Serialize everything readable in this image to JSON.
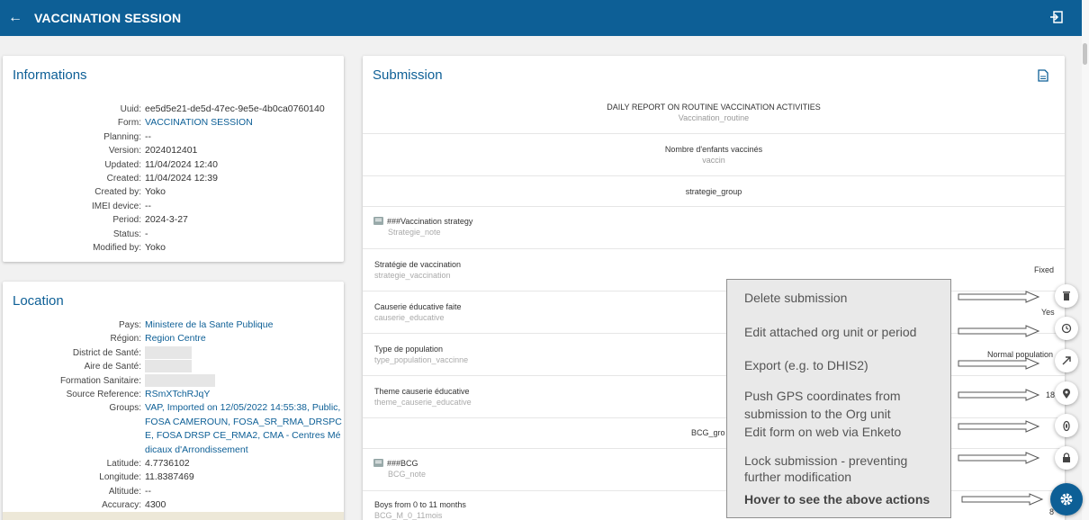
{
  "header": {
    "title": "VACCINATION SESSION",
    "back_icon": "arrow-left-icon",
    "exit_icon": "exit-icon"
  },
  "informations": {
    "title": "Informations",
    "rows": [
      {
        "k": "Uuid:",
        "v": "ee5d5e21-de5d-47ec-9e5e-4b0ca0760140"
      },
      {
        "k": "Form:",
        "v": "VACCINATION SESSION"
      },
      {
        "k": "Planning:",
        "v": "--"
      },
      {
        "k": "Version:",
        "v": "2024012401"
      },
      {
        "k": "Updated:",
        "v": "11/04/2024 12:40"
      },
      {
        "k": "Created:",
        "v": "11/04/2024 12:39"
      },
      {
        "k": "Created by:",
        "v": "Yoko"
      },
      {
        "k": "IMEI device:",
        "v": "--"
      },
      {
        "k": "Period:",
        "v": "2024-3-27"
      },
      {
        "k": "Status:",
        "v": "-"
      },
      {
        "k": "Modified by:",
        "v": "Yoko"
      }
    ]
  },
  "location": {
    "title": "Location",
    "rows": [
      {
        "k": "Pays:",
        "v": "Ministere de la Sante Publique"
      },
      {
        "k": "Région:",
        "v": "Region Centre"
      },
      {
        "k": "District de Santé:",
        "v": ""
      },
      {
        "k": "Aire de Santé:",
        "v": ""
      },
      {
        "k": "Formation Sanitaire:",
        "v": ""
      },
      {
        "k": "Source Reference:",
        "v": "RSmXTchRJqY"
      },
      {
        "k": "Groups:",
        "v": "VAP, Imported on 12/05/2022 14:55:38, Public,"
      },
      {
        "k": "",
        "v": "FOSA CAMEROUN, FOSA_SR_RMA_DRSPC"
      },
      {
        "k": "",
        "v": "E, FOSA DRSP CE_RMA2, CMA - Centres Mé"
      },
      {
        "k": "",
        "v": "dicaux d'Arrondissement"
      },
      {
        "k": "Latitude:",
        "v": "4.7736102"
      },
      {
        "k": "Longitude:",
        "v": "11.8387469"
      },
      {
        "k": "Altitude:",
        "v": "--"
      },
      {
        "k": "Accuracy:",
        "v": "4300"
      }
    ]
  },
  "submission": {
    "title": "Submission",
    "doc_icon": "document-icon",
    "header_main": "DAILY REPORT ON ROUTINE VACCINATION ACTIVITIES",
    "header_sub": "Vaccination_routine",
    "group1_main": "Nombre d'enfants vaccinés",
    "group1_sub": "vaccin",
    "group2_main": "strategie_group",
    "note1_main": "###Vaccination strategy",
    "note1_sub": "Strategie_note",
    "q1_main": "Stratégie de vaccination",
    "q1_sub": "strategie_vaccination",
    "q1_value": "Fixed",
    "q2_main": "Causerie éducative faite",
    "q2_sub": "causerie_educative",
    "q2_value": "Yes",
    "q3_main": "Type de population",
    "q3_sub": "type_population_vaccinne",
    "q3_value": "Normal population",
    "q4_main": "Theme causerie éducative",
    "q4_sub": "theme_causerie_educative",
    "q4_value": "18",
    "group3_main": "BCG_gro",
    "note2_main": "###BCG",
    "note2_sub": "BCG_note",
    "q5_main": "Boys from 0 to 11 months",
    "q5_sub": "BCG_M_0_11mois",
    "q5_value": "8"
  },
  "tooltip": {
    "delete": "Delete submission",
    "edit_org": "Edit attached org unit or period",
    "export": "Export (e.g. to DHIS2)",
    "push_gps_1": "Push GPS coordinates from",
    "push_gps_2": "submission to the Org unit",
    "edit_enketo": "Edit form on web via Enketo",
    "lock_1": "Lock submission - preventing",
    "lock_2": "further modification",
    "hover": "Hover to see the above actions"
  },
  "actions": {
    "icons": [
      "trash-icon",
      "restore-icon",
      "export-icon",
      "location-pin-icon",
      "enketo-icon",
      "lock-icon",
      "gear-icon"
    ]
  }
}
